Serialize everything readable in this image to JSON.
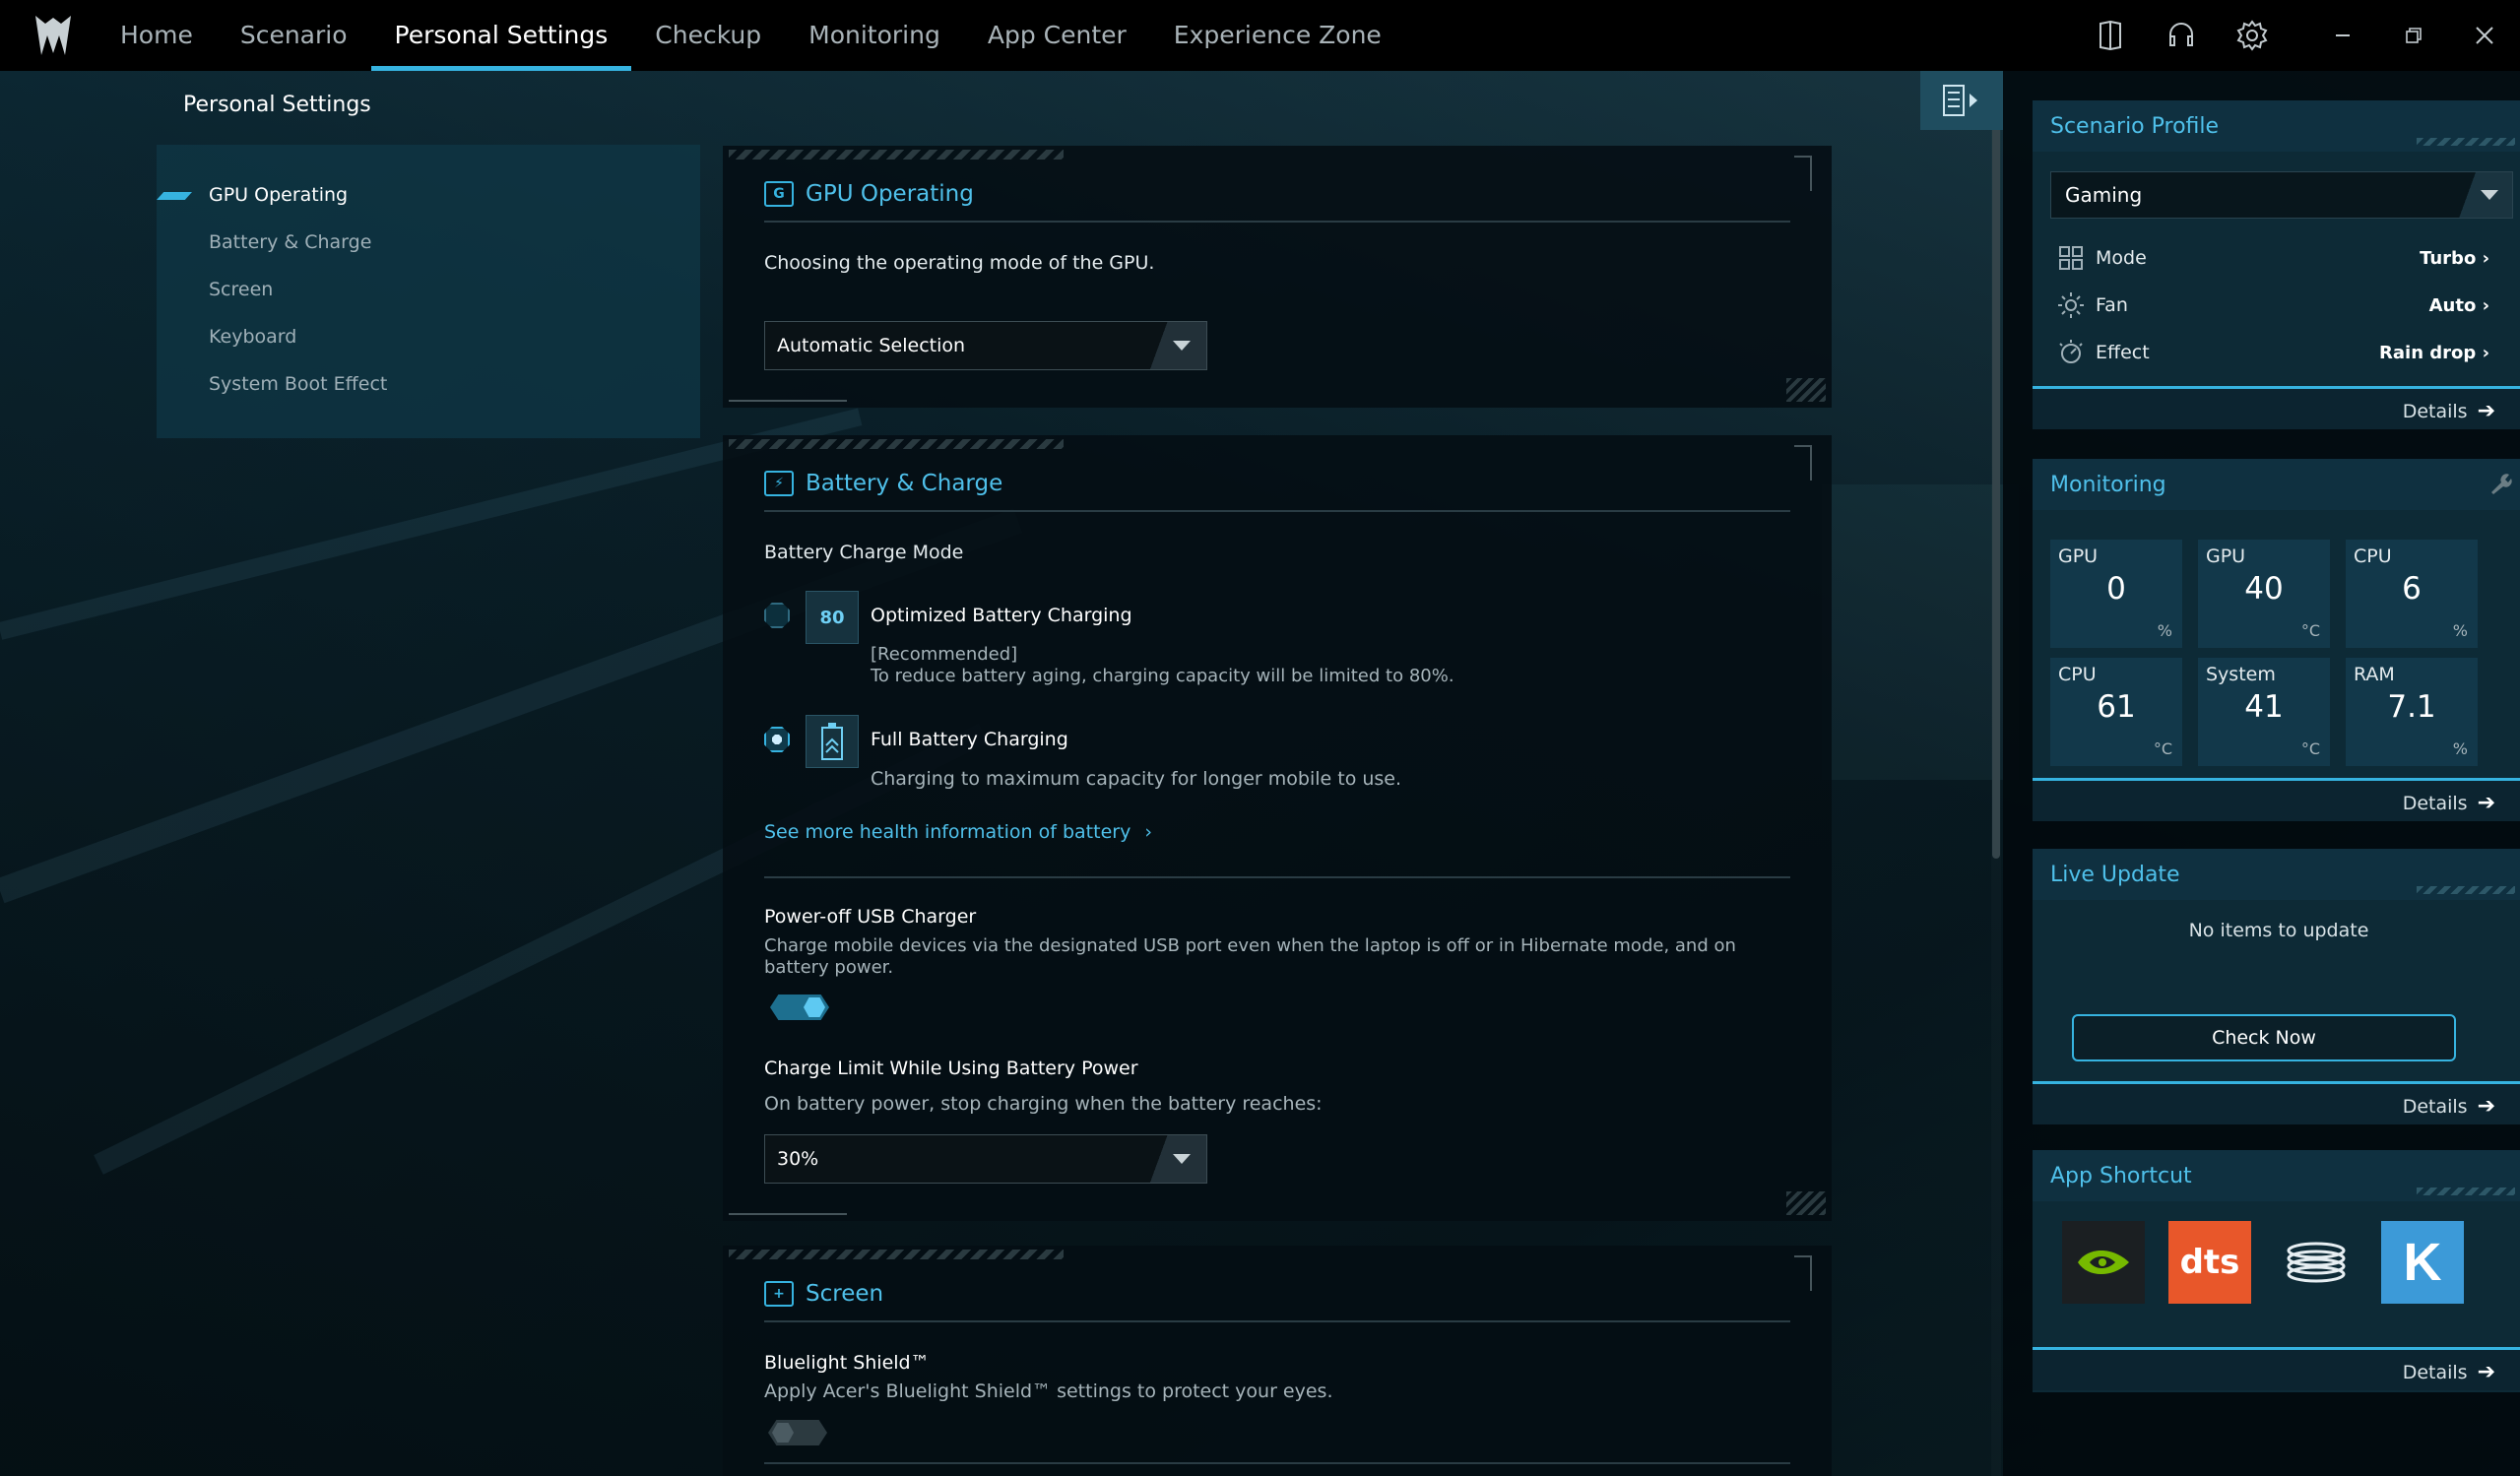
{
  "nav": {
    "items": [
      "Home",
      "Scenario",
      "Personal Settings",
      "Checkup",
      "Monitoring",
      "App Center",
      "Experience Zone"
    ],
    "active_index": 2
  },
  "page_title": "Personal Settings",
  "leftnav": {
    "items": [
      "GPU Operating",
      "Battery & Charge",
      "Screen",
      "Keyboard",
      "System Boot Effect"
    ],
    "active_index": 0
  },
  "gpu": {
    "title": "GPU Operating",
    "description": "Choosing the operating mode of the GPU.",
    "select_value": "Automatic Selection"
  },
  "battery": {
    "title": "Battery & Charge",
    "mode_label": "Battery Charge Mode",
    "opt1_title": "Optimized Battery Charging",
    "opt1_icon_text": "80",
    "opt1_tag": "[Recommended]",
    "opt1_desc": "To reduce battery aging, charging capacity will be limited to 80%.",
    "opt2_title": "Full Battery Charging",
    "opt2_desc": "Charging to maximum capacity for longer mobile to use.",
    "selected_option": 2,
    "health_link": "See more health information of battery",
    "usb_title": "Power-off USB Charger",
    "usb_desc": "Charge mobile devices via the designated USB port even when the laptop is off or in Hibernate mode, and on battery power.",
    "usb_enabled": true,
    "limit_title": "Charge Limit While Using Battery Power",
    "limit_desc": "On battery power, stop charging when the battery reaches:",
    "limit_value": "30%"
  },
  "screen": {
    "title": "Screen",
    "bluelight_title": "Bluelight Shield™",
    "bluelight_desc": "Apply Acer's Bluelight Shield™ settings to protect your eyes.",
    "bluelight_enabled": false
  },
  "scenario_profile": {
    "title": "Scenario Profile",
    "profile": "Gaming",
    "rows": [
      {
        "label": "Mode",
        "value": "Turbo",
        "icon": "grid-icon"
      },
      {
        "label": "Fan",
        "value": "Auto",
        "icon": "fan-icon"
      },
      {
        "label": "Effect",
        "value": "Rain drop",
        "icon": "effect-icon"
      }
    ],
    "details": "Details"
  },
  "monitoring": {
    "title": "Monitoring",
    "metrics": [
      {
        "label": "GPU",
        "value": "0",
        "unit": "%"
      },
      {
        "label": "GPU",
        "value": "40",
        "unit": "°C"
      },
      {
        "label": "CPU",
        "value": "6",
        "unit": "%"
      },
      {
        "label": "CPU",
        "value": "61",
        "unit": "°C"
      },
      {
        "label": "System",
        "value": "41",
        "unit": "°C"
      },
      {
        "label": "RAM",
        "value": "7.1",
        "unit": "%"
      }
    ],
    "details": "Details"
  },
  "live_update": {
    "title": "Live Update",
    "status": "No items to update",
    "button": "Check Now",
    "details": "Details"
  },
  "app_shortcut": {
    "title": "App Shortcut",
    "apps": [
      {
        "name": "nvidia-icon",
        "label": ""
      },
      {
        "name": "dts-icon",
        "label": "dts"
      },
      {
        "name": "coil-icon",
        "label": ""
      },
      {
        "name": "k-icon",
        "label": "K"
      }
    ],
    "details": "Details"
  },
  "colors": {
    "accent": "#36b3e0",
    "dts": "#e8572a",
    "nvidia": "#76b900",
    "k_app": "#3c9ad8"
  }
}
